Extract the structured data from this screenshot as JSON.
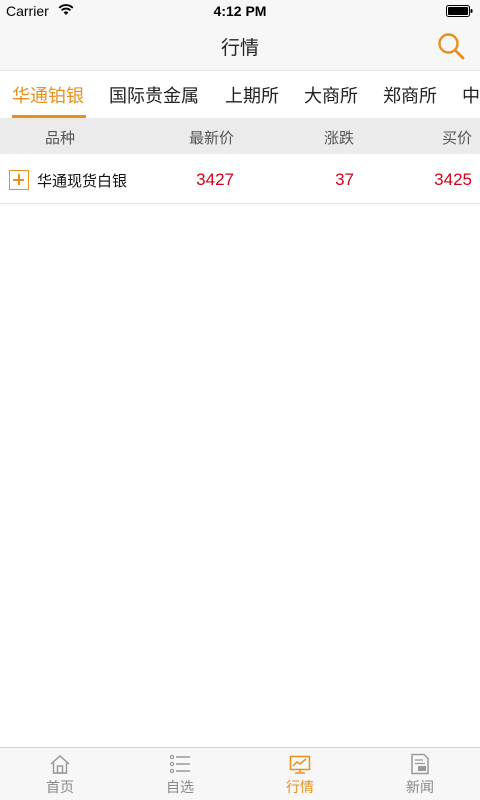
{
  "status_bar": {
    "carrier": "Carrier",
    "time": "4:12 PM"
  },
  "nav": {
    "title": "行情"
  },
  "tabs": [
    {
      "label": "华通铂银",
      "active": true
    },
    {
      "label": "国际贵金属",
      "active": false
    },
    {
      "label": "上期所",
      "active": false
    },
    {
      "label": "大商所",
      "active": false
    },
    {
      "label": "郑商所",
      "active": false
    },
    {
      "label": "中",
      "active": false
    }
  ],
  "table": {
    "columns": [
      "品种",
      "最新价",
      "涨跌",
      "买价"
    ],
    "rows": [
      {
        "name": "华通现货白银",
        "price": "3427",
        "change": "37",
        "bid": "3425"
      }
    ]
  },
  "tab_bar": [
    {
      "label": "首页",
      "icon": "home-icon",
      "active": false
    },
    {
      "label": "自选",
      "icon": "list-icon",
      "active": false
    },
    {
      "label": "行情",
      "icon": "chart-icon",
      "active": true
    },
    {
      "label": "新闻",
      "icon": "news-icon",
      "active": false
    }
  ],
  "colors": {
    "accent": "#e8901e",
    "price_up": "#d0021b"
  }
}
